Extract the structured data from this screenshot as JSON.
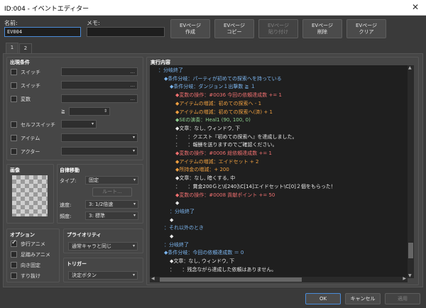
{
  "window": {
    "title": "ID:004 - イベントエディター",
    "close_icon": "close-icon"
  },
  "header": {
    "name_label": "名前:",
    "name_value": "EV004",
    "memo_label": "メモ:",
    "memo_value": "",
    "page_buttons": [
      {
        "line1": "EVページ",
        "line2": "作成"
      },
      {
        "line1": "EVページ",
        "line2": "コピー"
      },
      {
        "line1": "EVページ",
        "line2": "貼り付け"
      },
      {
        "line1": "EVページ",
        "line2": "削除"
      },
      {
        "line1": "EVページ",
        "line2": "クリア"
      }
    ]
  },
  "tabs": [
    "1",
    "2"
  ],
  "conditions": {
    "title": "出現条件",
    "switch1": "スイッチ",
    "switch2": "スイッチ",
    "variable": "変数",
    "gte": "≧",
    "self_switch": "セルフスイッチ",
    "item": "アイテム",
    "actor": "アクター",
    "dots": "..."
  },
  "image": {
    "title": "画像"
  },
  "autonomous": {
    "title": "自律移動",
    "type_label": "タイプ:",
    "type_value": "固定",
    "route_button": "ルート...",
    "speed_label": "速度:",
    "speed_value": "3: 1/2倍速",
    "freq_label": "頻度:",
    "freq_value": "3: 標準"
  },
  "options": {
    "title": "オプション",
    "items": [
      {
        "label": "歩行アニメ",
        "checked": true
      },
      {
        "label": "足踏みアニメ",
        "checked": false
      },
      {
        "label": "向き固定",
        "checked": false
      },
      {
        "label": "すり抜け",
        "checked": false
      }
    ]
  },
  "priority": {
    "title": "プライオリティ",
    "value": "通常キャラと同じ"
  },
  "trigger": {
    "title": "トリガー",
    "value": "決定ボタン"
  },
  "contents": {
    "title": "実行内容",
    "lines": [
      {
        "text": "：分岐終了",
        "indent": 0,
        "color": "blue"
      },
      {
        "text": "◆条件分岐：パーティが初めての探索へを持っている",
        "indent": 1,
        "color": "blue"
      },
      {
        "text": "◆条件分岐：ダンジョン１出撃数 ≧ １",
        "indent": 2,
        "color": "blue"
      },
      {
        "text": "◆変数の操作：#0036 今回の依頼達成数 += 1",
        "indent": 3,
        "color": "red"
      },
      {
        "text": "◆アイテムの増減：初めての探索へ - 1",
        "indent": 3,
        "color": "orange"
      },
      {
        "text": "◆アイテムの増減：初めての探索へ(済) + 1",
        "indent": 3,
        "color": "orange"
      },
      {
        "text": "◆SEの演奏：Heal1 (90, 100, 0)",
        "indent": 3,
        "color": "green"
      },
      {
        "text": "◆文章：なし, ウィンドウ, 下",
        "indent": 3,
        "color": "white"
      },
      {
        "text": "：　　：クエスト『初めての探索へ』を達成しました。",
        "indent": 3,
        "color": "white"
      },
      {
        "text": "：　　：報酬を送りますのでご確認ください。",
        "indent": 3,
        "color": "white"
      },
      {
        "text": "◆変数の操作：#0006 総依頼達成数 += 1",
        "indent": 3,
        "color": "red"
      },
      {
        "text": "◆アイテムの増減：エイドセット + 2",
        "indent": 3,
        "color": "orange"
      },
      {
        "text": "◆所持金の増減：+ 200",
        "indent": 3,
        "color": "orange"
      },
      {
        "text": "◆文章：なし, 暗くする, 中",
        "indent": 3,
        "color": "white"
      },
      {
        "text": "：　　：賞金200Ｇと\\I[240]\\C[14]エイドセット\\C[0]２個をもらった！",
        "indent": 3,
        "color": "white"
      },
      {
        "text": "◆変数の操作：#0008 貢献ポイント += 50",
        "indent": 3,
        "color": "red"
      },
      {
        "text": "◆",
        "indent": 3,
        "color": "white"
      },
      {
        "text": "：分岐終了",
        "indent": 2,
        "color": "blue"
      },
      {
        "text": "◆",
        "indent": 2,
        "color": "white"
      },
      {
        "text": "：それ以外のとき",
        "indent": 1,
        "color": "blue"
      },
      {
        "text": "◆",
        "indent": 2,
        "color": "white"
      },
      {
        "text": "：分岐終了",
        "indent": 1,
        "color": "blue"
      },
      {
        "text": "◆条件分岐：今回の依頼達成数 ＝ 0",
        "indent": 1,
        "color": "blue"
      },
      {
        "text": "◆文章：なし, ウィンドウ, 下",
        "indent": 2,
        "color": "white"
      },
      {
        "text": "：　　：残念ながら達成した依頼はありません。",
        "indent": 2,
        "color": "white"
      }
    ]
  },
  "footer": {
    "ok": "OK",
    "cancel": "キャンセル",
    "apply": "適用"
  },
  "colors": {
    "blue": "#7cb6f0",
    "orange": "#f0a040",
    "red": "#f07070",
    "white": "#e8e8e8",
    "green": "#8fd08f"
  }
}
